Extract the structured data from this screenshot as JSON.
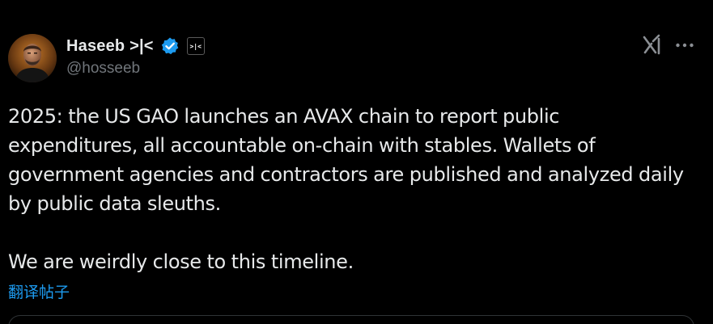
{
  "author": {
    "display_name": "Haseeb >|<",
    "handle": "@hosseeb",
    "badge_text": ">|<",
    "verified_color": "#1d9bf0"
  },
  "toolbar": {
    "grok_icon": "grok-icon",
    "more_icon": "more-icon"
  },
  "tweet": {
    "lines": [
      "2025: the US GAO launches an AVAX chain to report public",
      "expenditures, all accountable on-chain with stables. Wallets of",
      "government agencies and contractors are published and analyzed daily",
      "by public data sleuths.",
      "We are weirdly close to this timeline."
    ],
    "translate_label": "翻译帖子"
  },
  "colors": {
    "background": "#000000",
    "text": "#e7e9ea",
    "secondary": "#71767b",
    "link": "#1d9bf0"
  }
}
